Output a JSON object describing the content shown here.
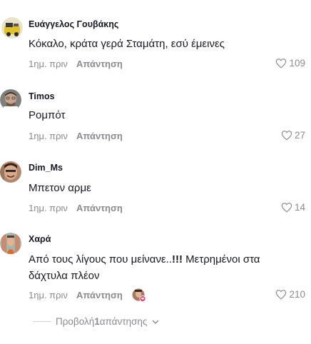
{
  "comments": [
    {
      "username": "Ευάγγελος Γουβάκης",
      "text": "Κόκαλο, κράτα γερά Σταμάτη, εσύ έμεινες",
      "time": "1ημ. πριν",
      "reply_label": "Απάντηση",
      "likes": "109"
    },
    {
      "username": "Timos",
      "text": "Ρομπότ",
      "time": "1ημ. πριν",
      "reply_label": "Απάντηση",
      "likes": "27"
    },
    {
      "username": "Dim_Ms",
      "text": "Μπετον αρμε",
      "time": "1ημ. πριν",
      "reply_label": "Απάντηση",
      "likes": "14"
    },
    {
      "username": "Χαρά",
      "text_before": "Από τους λίγους που μείνανε..",
      "text_bold": "!!!",
      "text_after": " Μετρημένοι στα δάχτυλα πλέον",
      "time": "1ημ. πριν",
      "reply_label": "Απάντηση",
      "likes": "210"
    }
  ],
  "view_replies": {
    "prefix": "Προβολή ",
    "count": "1",
    "suffix": " απάντησης"
  },
  "icons": {
    "like": "heart-outline-icon",
    "expand": "chevron-down-icon"
  },
  "colors": {
    "meta_gray": "#8a8b91",
    "text": "#161823",
    "liked_badge": "#fe2c55"
  }
}
